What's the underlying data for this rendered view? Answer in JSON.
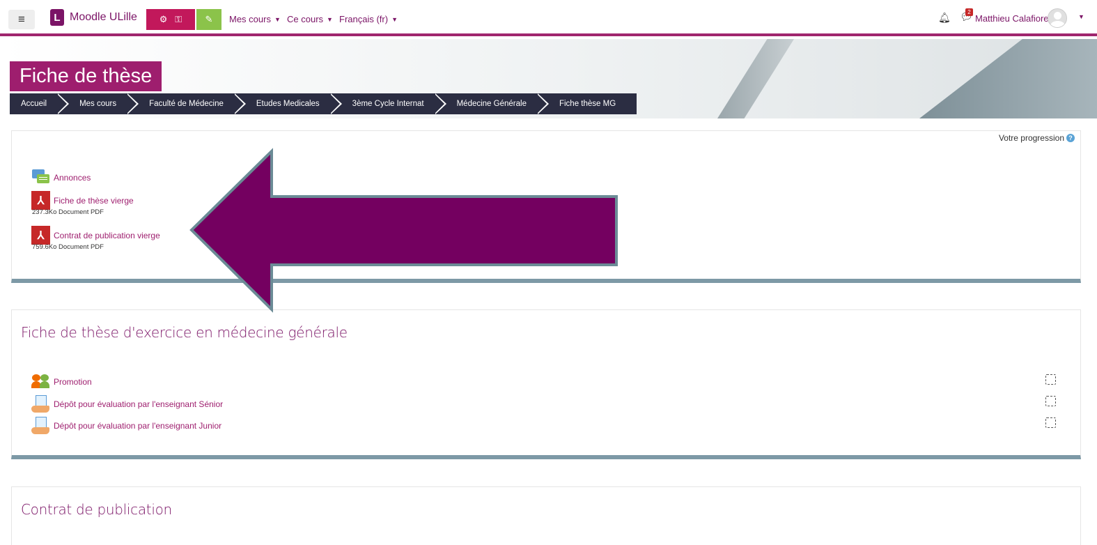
{
  "navbar": {
    "brand": "Moodle ULille",
    "brand_letter": "L",
    "menus": [
      {
        "label": "Mes cours"
      },
      {
        "label": "Ce cours"
      },
      {
        "label": "Français (fr)"
      }
    ],
    "notification_count": "2",
    "user_name": "Matthieu Calafiore"
  },
  "header": {
    "title": "Fiche de thèse",
    "breadcrumb": [
      "Accueil",
      "Mes cours",
      "Faculté de Médecine",
      "Etudes Medicales",
      "3ème Cycle Internat",
      "Médecine Générale",
      "Fiche thèse MG"
    ]
  },
  "progress_label": "Votre progression",
  "sections": [
    {
      "activities": [
        {
          "icon": "forum-icon",
          "label": "Annonces"
        },
        {
          "icon": "pdf-icon",
          "label": "Fiche de thèse vierge",
          "meta": "237.3Ko Document PDF"
        },
        {
          "icon": "pdf-icon",
          "label": "Contrat de publication vierge",
          "meta": "759.6Ko Document PDF"
        }
      ]
    },
    {
      "title": "Fiche de thèse d'exercice en médecine générale",
      "activities": [
        {
          "icon": "group-icon",
          "label": "Promotion"
        },
        {
          "icon": "assignment-icon",
          "label": "Dépôt pour évaluation par l'enseignant Sénior"
        },
        {
          "icon": "assignment-icon",
          "label": "Dépôt pour évaluation par l'enseignant Junior"
        }
      ]
    },
    {
      "title": "Contrat de publication"
    }
  ],
  "colors": {
    "brand": "#7b1466",
    "title_bg": "#9e1e6e",
    "breadcrumb_bg": "#2b2d42",
    "section_border": "#7d99a6",
    "annotation_arrow": "#740060"
  }
}
